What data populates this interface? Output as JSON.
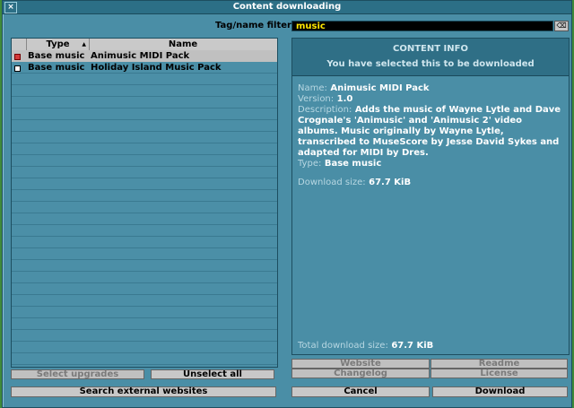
{
  "window": {
    "title": "Content downloading",
    "close_glyph": "×"
  },
  "filter": {
    "label": "Tag/name filter:",
    "value": "music",
    "clear_glyph": "⌫"
  },
  "list": {
    "headers": {
      "type": "Type",
      "name": "Name",
      "sort_glyph": "▲"
    },
    "rows": [
      {
        "type": "Base music",
        "name": "Animusic MIDI Pack",
        "selected": true
      },
      {
        "type": "Base music",
        "name": "Holiday Island Music Pack",
        "selected": false
      }
    ]
  },
  "info": {
    "title": "CONTENT INFO",
    "subtitle": "You have selected this to be downloaded",
    "name_label": "Name:",
    "name_value": "Animusic MIDI Pack",
    "version_label": "Version:",
    "version_value": "1.0",
    "description_label": "Description:",
    "description_value": "Adds the music of Wayne Lytle and Dave Crognale's 'Animusic' and 'Animusic 2' video albums. Music originally by Wayne Lytle, transcribed to MuseScore by Jesse David Sykes and adapted for MIDI by Dres.",
    "type_label": "Type:",
    "type_value": "Base music",
    "download_size_label": "Download size:",
    "download_size_value": "67.7 KiB",
    "total_label": "Total download size:",
    "total_value": "67.7 KiB"
  },
  "buttons": {
    "select_upgrades": "Select upgrades",
    "unselect_all": "Unselect all",
    "website": "Website",
    "readme": "Readme",
    "changelog": "Changelog",
    "license": "License",
    "search_external": "Search external websites",
    "cancel": "Cancel",
    "download": "Download"
  }
}
